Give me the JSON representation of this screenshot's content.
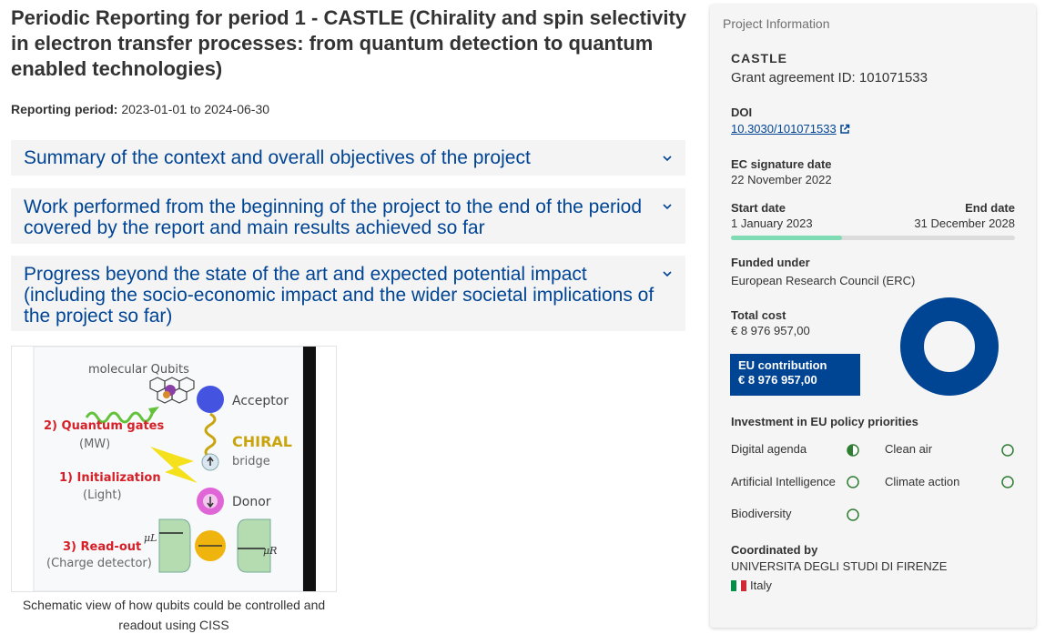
{
  "page": {
    "title": "Periodic Reporting for period 1 - CASTLE (Chirality and spin selectivity in electron transfer processes: from quantum detection to quantum enabled technologies)",
    "reporting_period_label": "Reporting period:",
    "reporting_period_value": "2023-01-01 to 2024-06-30"
  },
  "accordions": [
    {
      "label": "Summary of the context and overall objectives of the project",
      "icon": "chevron-down-icon"
    },
    {
      "label": "Work performed from the beginning of the project to the end of the period covered by the report and main results achieved so far",
      "icon": "chevron-down-icon"
    },
    {
      "label": "Progress beyond the state of the art and expected potential impact (including the socio-economic impact and the wider societal implications of the project so far)",
      "icon": "chevron-down-icon"
    }
  ],
  "figure": {
    "labels": {
      "molecular_qubits": "molecular Qubits",
      "acceptor": "Acceptor",
      "quantum_gates": "2) Quantum gates",
      "mw": "(MW)",
      "chiral": "CHIRAL",
      "bridge": "bridge",
      "initialization": "1) Initialization",
      "light": "(Light)",
      "donor": "Donor",
      "mu_l": "μL",
      "mu_r": "μR",
      "readout": "3) Read-out",
      "charge_detector": "(Charge detector)"
    },
    "caption": "Schematic view of how qubits could be controlled and readout using CISS"
  },
  "panel": {
    "header": "Project Information",
    "acronym": "CASTLE",
    "grant_label": "Grant agreement ID: 101071533",
    "doi_label": "DOI",
    "doi_value": "10.3030/101071533",
    "ec_signature_label": "EC signature date",
    "ec_signature_value": "22 November 2022",
    "start_label": "Start date",
    "start_value": "1 January 2023",
    "end_label": "End date",
    "end_value": "31 December 2028",
    "progress_fraction": 0.39,
    "funded_label": "Funded under",
    "funded_value": "European Research Council (ERC)",
    "total_cost_label": "Total cost",
    "total_cost_value": "€ 8 976 957,00",
    "eu_contribution_label": "EU contribution",
    "eu_contribution_value": "€ 8 976 957,00",
    "eu_share_fraction": 1.0,
    "investment_label": "Investment in EU policy priorities",
    "priorities": [
      {
        "label": "Digital agenda",
        "status": "half"
      },
      {
        "label": "Clean air",
        "status": "empty"
      },
      {
        "label": "Artificial Intelligence",
        "status": "empty"
      },
      {
        "label": "Climate action",
        "status": "empty"
      },
      {
        "label": "Biodiversity",
        "status": "empty"
      }
    ],
    "coordinated_label": "Coordinated by",
    "coordinator": "UNIVERSITA DEGLI STUDI DI FIRENZE",
    "country": "Italy"
  },
  "colors": {
    "accent_blue": "#004494",
    "progress_green": "#7fdcb4",
    "priority_green": "#2f7d32",
    "label_red": "#d61f26",
    "chiral_gold": "#c9a40c"
  }
}
